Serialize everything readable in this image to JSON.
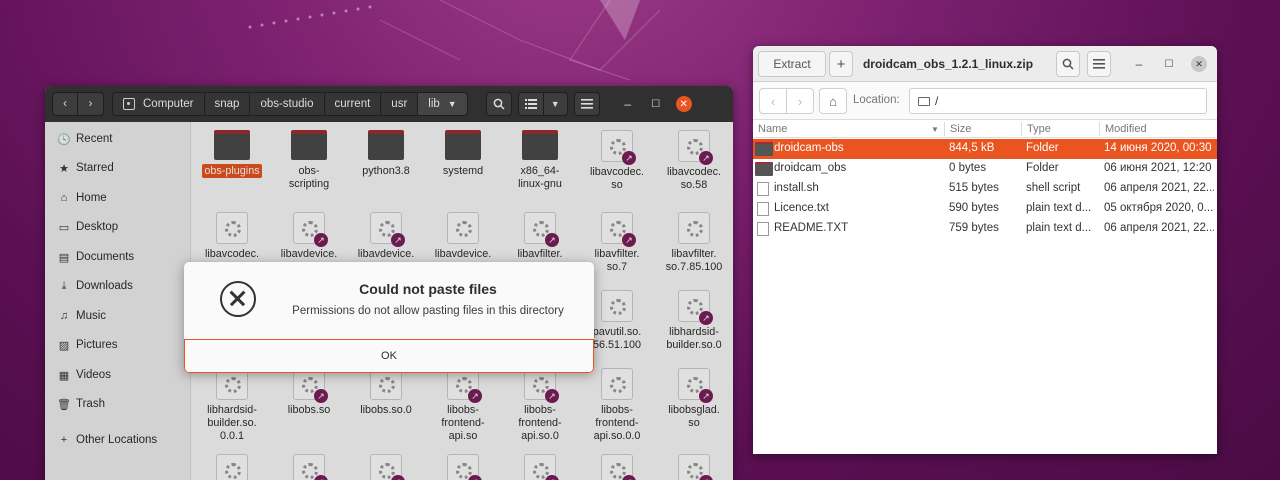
{
  "nautilus": {
    "breadcrumbs": [
      "Computer",
      "snap",
      "obs-studio",
      "current",
      "usr",
      "lib"
    ],
    "sidebar": [
      {
        "label": "Recent",
        "icon": "clock-icon"
      },
      {
        "label": "Starred",
        "icon": "star-icon"
      },
      {
        "label": "Home",
        "icon": "home-icon"
      },
      {
        "label": "Desktop",
        "icon": "desktop-icon"
      },
      {
        "label": "Documents",
        "icon": "documents-icon"
      },
      {
        "label": "Downloads",
        "icon": "downloads-icon"
      },
      {
        "label": "Music",
        "icon": "music-icon"
      },
      {
        "label": "Pictures",
        "icon": "pictures-icon"
      },
      {
        "label": "Videos",
        "icon": "videos-icon"
      },
      {
        "label": "Trash",
        "icon": "trash-icon"
      },
      {
        "label": "Other Locations",
        "icon": "plus-icon"
      }
    ],
    "files": [
      {
        "label": "obs-plugins",
        "kind": "folder",
        "selected": true
      },
      {
        "label": "obs-\nscripting",
        "kind": "folder"
      },
      {
        "label": "python3.8",
        "kind": "folder"
      },
      {
        "label": "systemd",
        "kind": "folder"
      },
      {
        "label": "x86_64-\nlinux-gnu",
        "kind": "folder"
      },
      {
        "label": "libavcodec.\nso",
        "kind": "link"
      },
      {
        "label": "libavcodec.\nso.58",
        "kind": "link"
      },
      {
        "label": "libavcodec.\nso.",
        "kind": "lib"
      },
      {
        "label": "libavdevice.\nso",
        "kind": "link"
      },
      {
        "label": "libavdevice.\nso.58",
        "kind": "link"
      },
      {
        "label": "libavdevice.\nso.",
        "kind": "lib"
      },
      {
        "label": "libavfilter.\nso",
        "kind": "link"
      },
      {
        "label": "libavfilter.\nso.7",
        "kind": "link"
      },
      {
        "label": "libavfilter.\nso.7.85.100",
        "kind": "lib"
      },
      {
        "label": "",
        "kind": "lib"
      },
      {
        "label": "",
        "kind": "lib"
      },
      {
        "label": "",
        "kind": "lib"
      },
      {
        "label": "",
        "kind": "lib"
      },
      {
        "label": "",
        "kind": "lib"
      },
      {
        "label": "pavutil.so.\n56.51.100",
        "kind": "lib"
      },
      {
        "label": "libhardsid-\nbuilder.so.0",
        "kind": "link"
      },
      {
        "label": "libhardsid-\nbuilder.so.\n0.0.1",
        "kind": "lib"
      },
      {
        "label": "libobs.so",
        "kind": "link"
      },
      {
        "label": "libobs.so.0",
        "kind": "lib"
      },
      {
        "label": "libobs-\nfrontend-\napi.so",
        "kind": "link"
      },
      {
        "label": "libobs-\nfrontend-\napi.so.0",
        "kind": "link"
      },
      {
        "label": "libobs-\nfrontend-\napi.so.0.0",
        "kind": "lib"
      },
      {
        "label": "libobsglad.\nso",
        "kind": "link"
      },
      {
        "label": "",
        "kind": "lib"
      },
      {
        "label": "",
        "kind": "link"
      },
      {
        "label": "",
        "kind": "link"
      },
      {
        "label": "",
        "kind": "link"
      },
      {
        "label": "",
        "kind": "link"
      },
      {
        "label": "",
        "kind": "link"
      },
      {
        "label": "",
        "kind": "link"
      }
    ],
    "dialog": {
      "title": "Could not paste files",
      "message": "Permissions do not allow pasting files in this directory",
      "ok_label": "OK"
    }
  },
  "roller": {
    "extract_label": "Extract",
    "add_label": "+",
    "title": "droidcam_obs_1.2.1_linux.zip",
    "location_label": "Location:",
    "location_value": "/",
    "columns": {
      "name": "Name",
      "size": "Size",
      "type": "Type",
      "modified": "Modified"
    },
    "rows": [
      {
        "name": "droidcam-obs",
        "size": "844,5 kB",
        "type": "Folder",
        "modified": "14 июня 2020, 00:30",
        "kind": "folder",
        "selected": true
      },
      {
        "name": "droidcam_obs",
        "size": "0 bytes",
        "type": "Folder",
        "modified": "06 июня 2021, 12:20",
        "kind": "folder"
      },
      {
        "name": "install.sh",
        "size": "515 bytes",
        "type": "shell script",
        "modified": "06 апреля 2021, 22...",
        "kind": "file"
      },
      {
        "name": "Licence.txt",
        "size": "590 bytes",
        "type": "plain text d...",
        "modified": "05 октября 2020, 0...",
        "kind": "file"
      },
      {
        "name": "README.TXT",
        "size": "759 bytes",
        "type": "plain text d...",
        "modified": "06 апреля 2021, 22...",
        "kind": "file"
      }
    ]
  },
  "colors": {
    "accent": "#e95420",
    "titlebar_dark": "#303030",
    "link_badge": "#7b1f5c"
  }
}
